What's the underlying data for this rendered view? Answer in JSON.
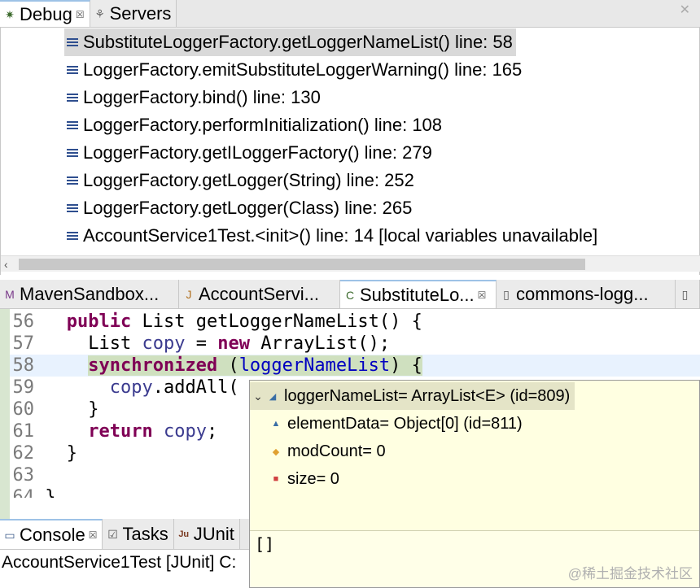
{
  "debug_tabs": [
    {
      "label": "Debug",
      "close": "☒"
    },
    {
      "label": "Servers"
    }
  ],
  "minimize_glyph": "✕",
  "stack_frames": [
    "SubstituteLoggerFactory.getLoggerNameList() line: 58",
    "LoggerFactory.emitSubstituteLoggerWarning() line: 165",
    "LoggerFactory.bind() line: 130",
    "LoggerFactory.performInitialization() line: 108",
    "LoggerFactory.getILoggerFactory() line: 279",
    "LoggerFactory.getLogger(String) line: 252",
    "LoggerFactory.getLogger(Class) line: 265",
    "AccountService1Test.<init>() line: 14 [local variables unavailable]"
  ],
  "editor_tabs": [
    {
      "label": "MavenSandbox..."
    },
    {
      "label": "AccountServi..."
    },
    {
      "label": "SubstituteLo...",
      "close": "☒"
    },
    {
      "label": "commons-logg..."
    },
    {
      "label": ""
    }
  ],
  "code_lines": {
    "n56": "56",
    "n57": "57",
    "n58": "58",
    "n59": "59",
    "n60": "60",
    "n61": "61",
    "n62": "62",
    "n63": "63",
    "n64": "64",
    "l56_kw": "public",
    "l56_rest": " List getLoggerNameList() {",
    "l57_a": "List ",
    "l57_var": "copy",
    "l57_b": " = ",
    "l57_kw": "new",
    "l57_c": " ArrayList();",
    "l58_kw": "synchronized",
    "l58_a": " (",
    "l58_fld": "loggerNameList",
    "l58_b": ") {",
    "l59_var": "copy",
    "l59_a": ".addAll(",
    "l60_a": "}",
    "l61_kw": "return",
    "l61_var": " copy",
    "l61_a": ";",
    "l62_a": "}",
    "l64_a": "}"
  },
  "popup": {
    "root": "loggerNameList= ArrayList<E>  (id=809)",
    "children": [
      {
        "label": "elementData= Object[0]  (id=811)",
        "icon": "▲",
        "color": "#3a6ea5"
      },
      {
        "label": "modCount= 0",
        "icon": "◆",
        "color": "#e0a030"
      },
      {
        "label": "size= 0",
        "icon": "■",
        "color": "#d04040"
      }
    ],
    "detail": "[]"
  },
  "console_tabs": [
    {
      "label": "Console",
      "close": "☒"
    },
    {
      "label": "Tasks"
    },
    {
      "label": "JUnit"
    }
  ],
  "console_text": "AccountService1Test [JUnit] C:",
  "watermark": "@稀土掘金技术社区"
}
